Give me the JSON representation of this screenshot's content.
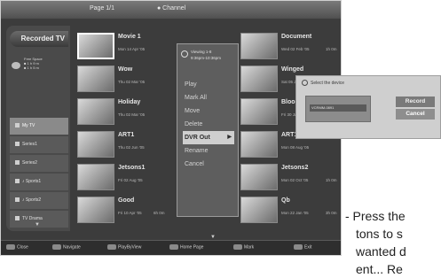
{
  "topbar": {
    "left": "Page 1/1",
    "mid": "● Channel",
    "right": ""
  },
  "sidebar": {
    "brand": "Recorded TV",
    "disk_lines": [
      "Free Space",
      "■ 1 h 9 m",
      "■ 1 h 5 m"
    ],
    "categories": [
      {
        "label": "My TV"
      },
      {
        "label": "Series1"
      },
      {
        "label": "Series2"
      },
      {
        "label": "♪ Sports1"
      },
      {
        "label": "♪ Sports2"
      },
      {
        "label": "TV Drama"
      }
    ],
    "down_arrow": "▼"
  },
  "recordings_col1": [
    {
      "title": "Movie 1",
      "meta": "Mon 14 Apr '05"
    },
    {
      "title": "Wow",
      "meta": "Thu 02 Mar '05"
    },
    {
      "title": "Holiday",
      "meta": "Thu 02 Mar '05"
    },
    {
      "title": "ART1",
      "meta": "Thu 02 Jun '05"
    },
    {
      "title": "Jetsons1",
      "meta": "Fri 02 Aug '05"
    },
    {
      "title": "Good",
      "meta": "Fri 10 Apr '05",
      "meta2": "6h 0m"
    }
  ],
  "recordings_col2": [
    {
      "title": "Document",
      "meta": "Wed 02 Feb '05",
      "meta2": "1h 0m"
    },
    {
      "title": "Winged",
      "meta": "Sat 05 Jan '05"
    },
    {
      "title": "Bloom.",
      "meta": "Fri 30 Jan '05"
    },
    {
      "title": "ART1",
      "meta": "Mon 08 Aug '05"
    },
    {
      "title": "Jetsons2",
      "meta": "Mon 02 Oct '05",
      "meta2": "1h 0m"
    },
    {
      "title": "Qb",
      "meta": "Mon 22 Jan '05",
      "meta2": "3h 0m"
    }
  ],
  "context_menu": {
    "head_line1": "Viewing 1-8",
    "head_line2": "9:36pm-10:36pm",
    "items": [
      {
        "label": "Play"
      },
      {
        "label": "Mark All"
      },
      {
        "label": "Move"
      },
      {
        "label": "Delete"
      },
      {
        "label": "DVR Out",
        "arrow": "▶"
      },
      {
        "label": "Rename"
      },
      {
        "label": "Cancel"
      }
    ]
  },
  "bottombar": {
    "hints": [
      "Close",
      "Navigate",
      "PlayByView",
      "Home Page",
      "Mark",
      "Exit"
    ],
    "down_arrow": "▼"
  },
  "popup": {
    "title": "Select the device",
    "device": "VCRMM-0891",
    "record": "Record",
    "cancel": "Cancel"
  },
  "instructions": {
    "line1": "- Press the",
    "line2": "tons to s",
    "line3": "wanted d",
    "line4": "ent... Re"
  }
}
